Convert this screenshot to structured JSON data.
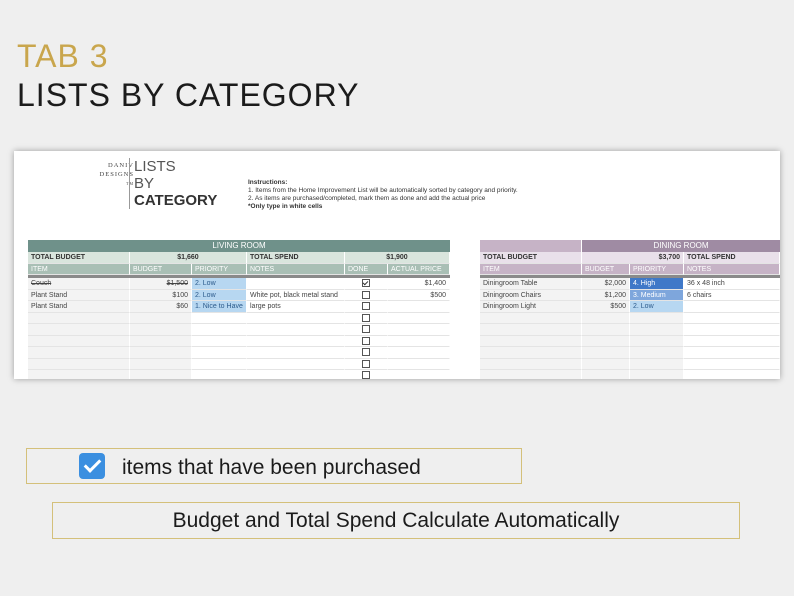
{
  "heading": {
    "tab": "TAB 3",
    "title": "LISTS BY CATEGORY"
  },
  "logo": {
    "line1": "DANIV",
    "line2": "DESIGNS",
    "tm": "TM"
  },
  "sheet_title": {
    "line1": "LISTS",
    "line2": "BY",
    "line3": "CATEGORY"
  },
  "instructions": {
    "label": "Instructions:",
    "line1": "1. Items from the Home Improvement List will be automatically sorted by category and priority.",
    "line2": "2. As items are purchased/completed, mark them as done and add the actual price",
    "line3": "*Only type in white cells"
  },
  "living_room": {
    "title": "LIVING ROOM",
    "total_budget_label": "TOTAL BUDGET",
    "total_budget": "$1,660",
    "total_spend_label": "TOTAL SPEND",
    "total_spend": "$1,900",
    "columns": [
      "ITEM",
      "BUDGET",
      "PRIORITY",
      "NOTES",
      "DONE",
      "ACTUAL PRICE"
    ],
    "rows": [
      {
        "item": "Couch",
        "budget": "$1,500",
        "priority": "2. Low",
        "notes": "",
        "done": true,
        "actual": "$1,400",
        "strike": true
      },
      {
        "item": "Plant Stand",
        "budget": "$100",
        "priority": "2. Low",
        "notes": "White pot, black metal stand",
        "done": false,
        "actual": "$500"
      },
      {
        "item": "Plant Stand",
        "budget": "$60",
        "priority": "1. Nice to Have",
        "notes": "large pots",
        "done": false,
        "actual": ""
      }
    ],
    "empty_rows": 6
  },
  "dining_room": {
    "title": "DINING ROOM",
    "total_budget_label": "TOTAL BUDGET",
    "total_budget": "$3,700",
    "total_spend_label": "TOTAL SPEND",
    "columns": [
      "ITEM",
      "BUDGET",
      "PRIORITY",
      "NOTES"
    ],
    "rows": [
      {
        "item": "Diningroom Table",
        "budget": "$2,000",
        "priority": "4. High",
        "notes": "36 x 48 inch"
      },
      {
        "item": "Diningroom Chairs",
        "budget": "$1,200",
        "priority": "3. Medium",
        "notes": "6 chairs"
      },
      {
        "item": "Diningroom Light",
        "budget": "$500",
        "priority": "2. Low",
        "notes": ""
      }
    ]
  },
  "colors": {
    "living_banner": "#6f918a",
    "living_header": "#a9bfb5",
    "living_total": "#d9e5dd",
    "dining_banner": "#9f8ba3",
    "dining_header": "#c6b3c6",
    "dining_total": "#e9e0ea",
    "priority_high": "#3f78c8",
    "priority_medium": "#7ea6dc",
    "priority_low": "#b7d7f1",
    "accent_gold": "#c9a64d"
  },
  "notes": {
    "purchased": "items that have been purchased",
    "auto": "Budget and Total Spend Calculate Automatically"
  }
}
